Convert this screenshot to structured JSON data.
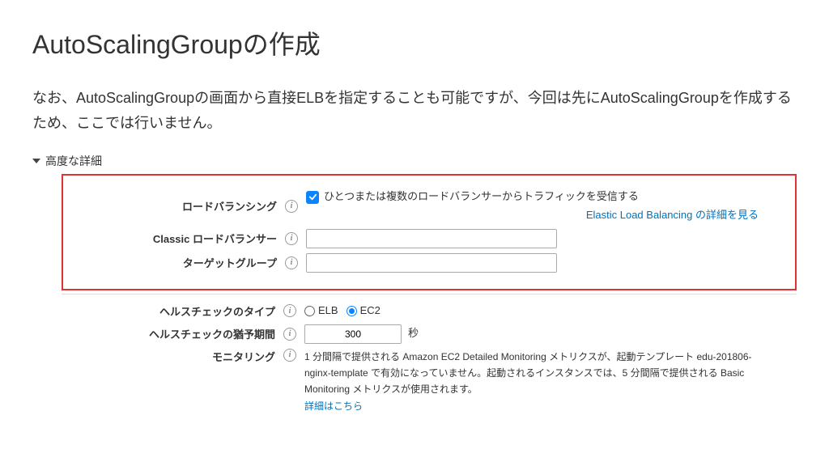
{
  "header": {
    "title": "AutoScalingGroupの作成"
  },
  "description": "なお、AutoScalingGroupの画面から直接ELBを指定することも可能ですが、今回は先にAutoScalingGroupを作成するため、ここでは行いません。",
  "collapsible": {
    "label": "高度な詳細"
  },
  "form": {
    "load_balancing": {
      "label": "ロードバランシング",
      "checkbox_label": "ひとつまたは複数のロードバランサーからトラフィックを受信する",
      "link": "Elastic Load Balancing の詳細を見る"
    },
    "classic_lb": {
      "label": "Classic ロードバランサー",
      "value": ""
    },
    "target_group": {
      "label": "ターゲットグループ",
      "value": ""
    },
    "health_check_type": {
      "label": "ヘルスチェックのタイプ",
      "options": {
        "elb": "ELB",
        "ec2": "EC2"
      }
    },
    "health_check_grace": {
      "label": "ヘルスチェックの猶予期間",
      "value": "300",
      "unit": "秒"
    },
    "monitoring": {
      "label": "モニタリング",
      "text": "1 分間隔で提供される Amazon EC2 Detailed Monitoring メトリクスが、起動テンプレート edu-201806-nginx-template で有効になっていません。起動されるインスタンスでは、5 分間隔で提供される Basic Monitoring メトリクスが使用されます。",
      "link": "詳細はこちら"
    }
  }
}
